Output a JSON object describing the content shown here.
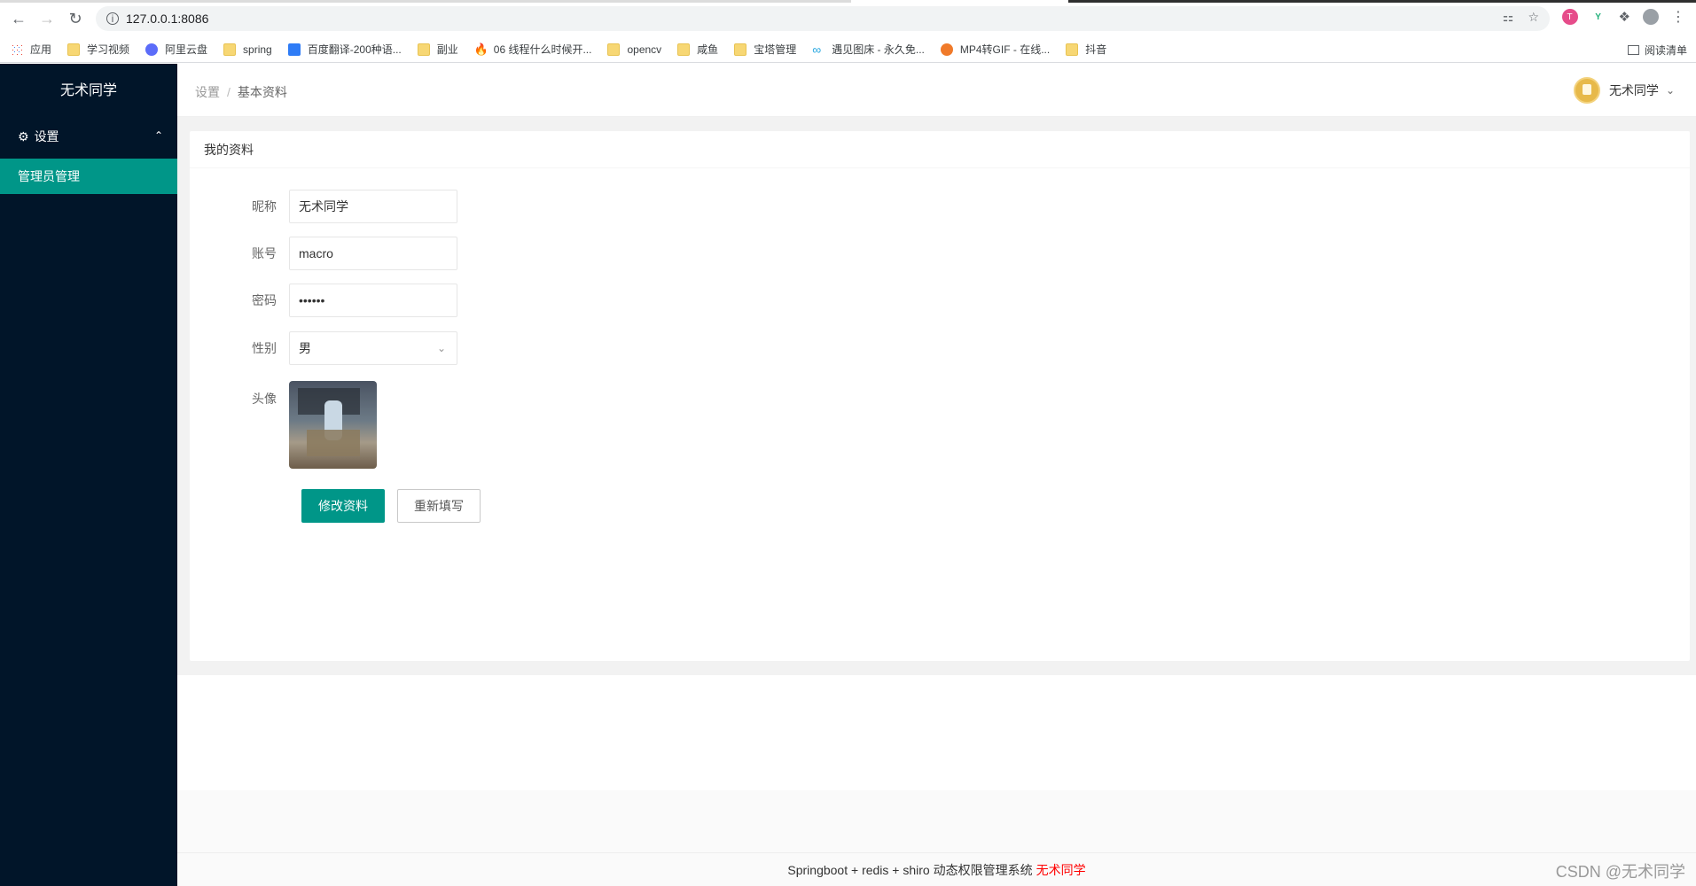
{
  "browser": {
    "url": "127.0.0.1:8086",
    "bookmarks": [
      {
        "label": "应用",
        "icon": "apps-grid-icon",
        "color": "#4285f4"
      },
      {
        "label": "学习视频",
        "icon": "folder-icon"
      },
      {
        "label": "阿里云盘",
        "icon": "aliyun-drive-icon",
        "color": "#5b6cf9"
      },
      {
        "label": "spring",
        "icon": "folder-icon"
      },
      {
        "label": "百度翻译-200种语...",
        "icon": "baidu-translate-icon",
        "color": "#2f7cf6"
      },
      {
        "label": "副业",
        "icon": "folder-icon"
      },
      {
        "label": "06 线程什么时候开...",
        "icon": "flame-icon",
        "color": "#e8502b"
      },
      {
        "label": "opencv",
        "icon": "folder-icon"
      },
      {
        "label": "咸鱼",
        "icon": "folder-icon"
      },
      {
        "label": "宝塔管理",
        "icon": "folder-icon"
      },
      {
        "label": "遇见图床 - 永久免...",
        "icon": "infinity-icon",
        "color": "#29a8e0"
      },
      {
        "label": "MP4转GIF - 在线...",
        "icon": "convert-icon",
        "color": "#f07a2a"
      },
      {
        "label": "抖音",
        "icon": "folder-icon"
      }
    ],
    "reading_list": "阅读清单"
  },
  "sidebar": {
    "title": "无术同学",
    "group_label": "设置",
    "item_label": "管理员管理"
  },
  "header": {
    "breadcrumb_root": "设置",
    "breadcrumb_sep": "/",
    "breadcrumb_current": "基本资料",
    "user_name": "无术同学"
  },
  "card": {
    "title": "我的资料"
  },
  "form": {
    "nickname_label": "昵称",
    "nickname_value": "无术同学",
    "account_label": "账号",
    "account_value": "macro",
    "password_label": "密码",
    "password_value": "••••••",
    "gender_label": "性别",
    "gender_value": "男",
    "avatar_label": "头像",
    "submit_label": "修改资料",
    "reset_label": "重新填写"
  },
  "footer": {
    "text": "Springboot + redis + shiro 动态权限管理系统",
    "author": "无术同学"
  },
  "watermark": "CSDN @无术同学",
  "colors": {
    "sidebar_bg": "#011529",
    "accent": "#009688",
    "author": "#ff0000"
  }
}
